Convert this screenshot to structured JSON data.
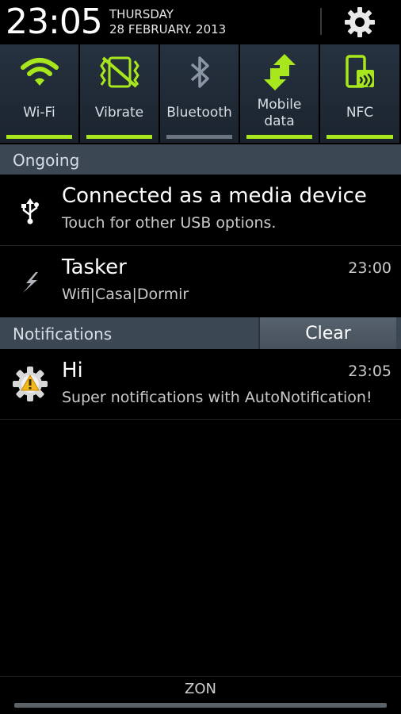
{
  "header": {
    "time": "23:05",
    "day": "THURSDAY",
    "date": "28 FEBRUARY. 2013",
    "settings_icon": "gear-icon"
  },
  "toggles": [
    {
      "label": "Wi-Fi",
      "icon": "wifi-icon",
      "active": true
    },
    {
      "label": "Vibrate",
      "icon": "vibrate-icon",
      "active": true
    },
    {
      "label": "Bluetooth",
      "icon": "bluetooth-icon",
      "active": false
    },
    {
      "label_line1": "Mobile",
      "label_line2": "data",
      "icon": "mobile-data-icon",
      "active": true
    },
    {
      "label": "NFC",
      "icon": "nfc-icon",
      "active": true
    }
  ],
  "colors": {
    "accent_green": "#a8e61d",
    "inactive_bar": "#6b7581",
    "section_header": "#3b4854",
    "toggle_bg": "#263240"
  },
  "ongoing": {
    "title": "Ongoing",
    "items": [
      {
        "title": "Connected as a media device",
        "text": "Touch for other USB options.",
        "time": "",
        "icon": "usb-icon"
      },
      {
        "title": "Tasker",
        "text": "Wifi|Casa|Dormir",
        "time": "23:00",
        "icon": "tasker-bolt-icon"
      }
    ]
  },
  "notifications": {
    "title": "Notifications",
    "clear_label": "Clear",
    "items": [
      {
        "title": "Hi",
        "text": "Super notifications with AutoNotification!",
        "time": "23:05",
        "icon": "autonotification-icon"
      }
    ]
  },
  "footer": {
    "carrier": "ZON"
  }
}
